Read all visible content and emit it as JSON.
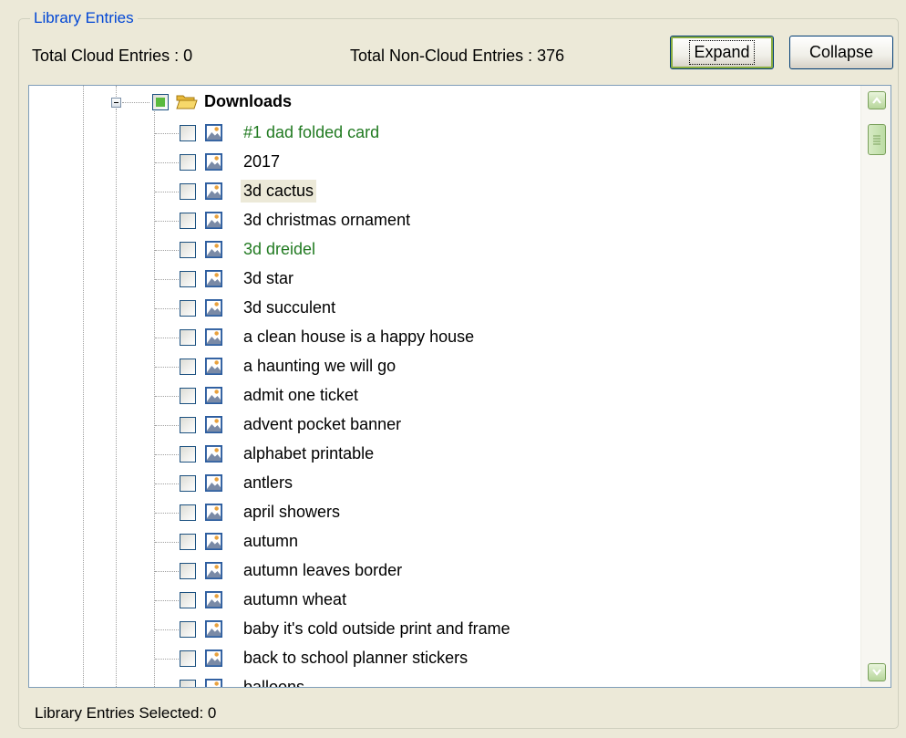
{
  "group": {
    "title": "Library Entries"
  },
  "stats": {
    "cloud": "Total Cloud Entries : 0",
    "noncloud": "Total Non-Cloud Entries : 376"
  },
  "buttons": {
    "expand": "Expand",
    "collapse": "Collapse"
  },
  "tree": {
    "root": {
      "label": "Downloads",
      "icon": "folder-open-icon",
      "check_state": "partial",
      "expanded": true
    },
    "items": [
      {
        "label": "#1 dad folded card",
        "status": "green"
      },
      {
        "label": "2017",
        "status": "normal"
      },
      {
        "label": "3d cactus",
        "status": "highlighted"
      },
      {
        "label": "3d christmas ornament",
        "status": "normal"
      },
      {
        "label": "3d dreidel",
        "status": "green"
      },
      {
        "label": "3d star",
        "status": "normal"
      },
      {
        "label": "3d succulent",
        "status": "normal"
      },
      {
        "label": "a clean house is a happy house",
        "status": "normal"
      },
      {
        "label": "a haunting we will go",
        "status": "normal"
      },
      {
        "label": "admit one ticket",
        "status": "normal"
      },
      {
        "label": "advent pocket banner",
        "status": "normal"
      },
      {
        "label": "alphabet printable",
        "status": "normal"
      },
      {
        "label": "antlers",
        "status": "normal"
      },
      {
        "label": "april showers",
        "status": "normal"
      },
      {
        "label": "autumn",
        "status": "normal"
      },
      {
        "label": "autumn leaves border",
        "status": "normal"
      },
      {
        "label": "autumn wheat",
        "status": "normal"
      },
      {
        "label": "baby it's cold outside print and frame",
        "status": "normal"
      },
      {
        "label": "back to school planner stickers",
        "status": "normal"
      },
      {
        "label": "balloons",
        "status": "normal"
      }
    ]
  },
  "status_bar": {
    "selected": "Library Entries Selected: 0"
  },
  "colors": {
    "green_text": "#217a21",
    "title_blue": "#0046d5",
    "highlight": "#ece9d8"
  }
}
